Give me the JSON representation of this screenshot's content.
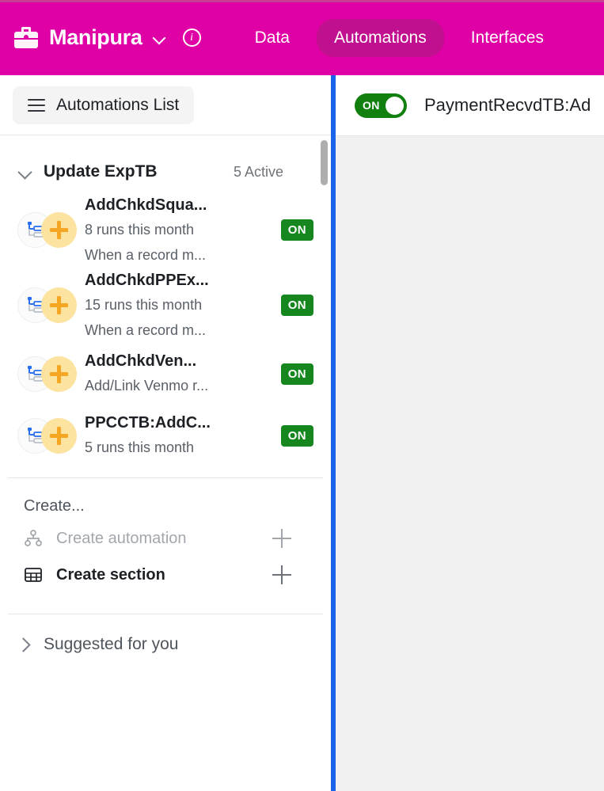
{
  "topbar": {
    "base_icon": "briefcase-icon",
    "base_name": "Manipura",
    "dropdown_icon": "chevron-down-icon",
    "info_icon": "info-circle-icon",
    "nav": [
      {
        "label": "Data",
        "active": false
      },
      {
        "label": "Automations",
        "active": true
      },
      {
        "label": "Interfaces",
        "active": false
      }
    ],
    "brand_color": "#df01a5",
    "active_pill_color": "#c00f8f"
  },
  "sidebar": {
    "list_button": {
      "icon": "hamburger-icon",
      "label": "Automations List"
    },
    "section": {
      "chevron": "chevron-down-icon",
      "title": "Update ExpTB",
      "count": "5 Active"
    },
    "automations": [
      {
        "icon": "automation-flow-icon",
        "badge_icon": "plus-circle-icon",
        "title": "AddChkdSqua...",
        "runs": "8 runs this month",
        "description": "When a record m...",
        "status": "ON"
      },
      {
        "icon": "automation-flow-icon",
        "badge_icon": "plus-circle-icon",
        "title": "AddChkdPPEx...",
        "runs": "15 runs this month",
        "description": "When a record m...",
        "status": "ON"
      },
      {
        "icon": "automation-flow-icon",
        "badge_icon": "plus-circle-icon",
        "title": "AddChkdVen...",
        "runs": "",
        "description": "Add/Link Venmo r...",
        "status": "ON"
      },
      {
        "icon": "automation-flow-icon",
        "badge_icon": "plus-circle-icon",
        "title": "PPCCTB:AddC...",
        "runs": "5 runs this month",
        "description": "",
        "status": "ON"
      }
    ],
    "create": {
      "heading": "Create...",
      "items": [
        {
          "icon": "sitemap-icon",
          "label": "Create automation",
          "disabled": true,
          "add_icon": "plus-icon"
        },
        {
          "icon": "table-grid-icon",
          "label": "Create section",
          "disabled": false,
          "add_icon": "plus-icon"
        }
      ]
    },
    "suggested": {
      "chevron": "chevron-right-icon",
      "label": "Suggested for you"
    },
    "scrollbar": "vertical-scrollbar"
  },
  "splitter": {
    "name": "panel-splitter",
    "color": "#1b63e8"
  },
  "right_panel": {
    "toggle": {
      "label": "ON",
      "state": "on",
      "color": "#12800f"
    },
    "title": "PaymentRecvdTB:Ad",
    "body_color": "#f0f0f0"
  }
}
